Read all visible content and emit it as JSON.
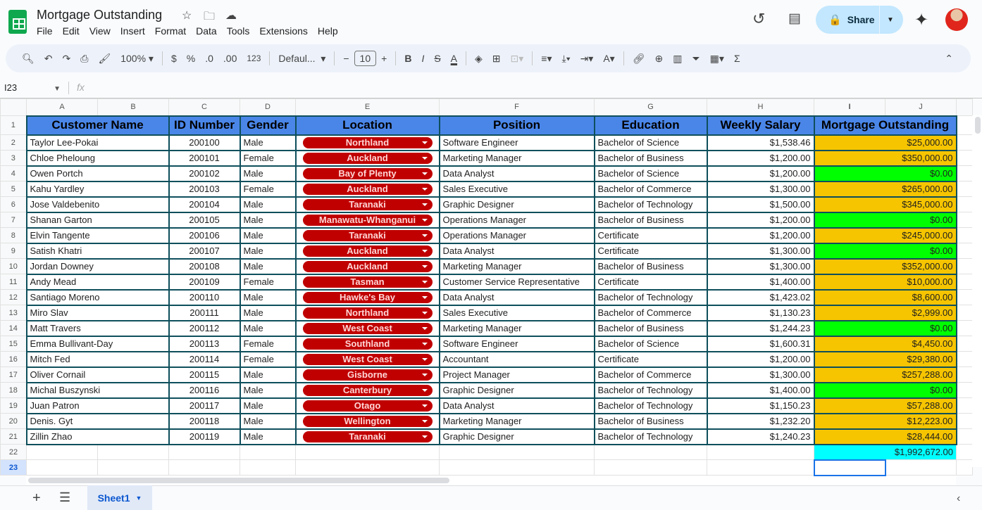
{
  "app": {
    "title": "Mortgage Outstanding",
    "menu": [
      "File",
      "Edit",
      "View",
      "Insert",
      "Format",
      "Data",
      "Tools",
      "Extensions",
      "Help"
    ],
    "share_label": "Share"
  },
  "toolbar": {
    "zoom": "100%",
    "currency": "$",
    "percent": "%",
    "dec_decrease": ".0",
    "dec_increase": ".00",
    "format_123": "123",
    "font": "Defaul...",
    "font_size": "10"
  },
  "formula_bar": {
    "name_box": "I23",
    "fx": "fx"
  },
  "columns": [
    "A",
    "B",
    "C",
    "D",
    "E",
    "F",
    "G",
    "H",
    "I",
    "J"
  ],
  "headers": {
    "name": "Customer Name",
    "id": "ID Number",
    "gender": "Gender",
    "location": "Location",
    "position": "Position",
    "education": "Education",
    "salary": "Weekly Salary",
    "mortgage": "Mortgage Outstanding"
  },
  "rows": [
    {
      "name": "Taylor Lee-Pokai",
      "id": "200100",
      "gender": "Male",
      "location": "Northland",
      "position": "Software Engineer",
      "education": "Bachelor of Science",
      "salary": "$1,538.46",
      "mortgage": "$25,000.00"
    },
    {
      "name": "Chloe Pheloung",
      "id": "200101",
      "gender": "Female",
      "location": "Auckland",
      "position": "Marketing Manager",
      "education": "Bachelor of Business",
      "salary": "$1,200.00",
      "mortgage": "$350,000.00"
    },
    {
      "name": "Owen Portch",
      "id": "200102",
      "gender": "Male",
      "location": "Bay of Plenty",
      "position": "Data Analyst",
      "education": "Bachelor of Science",
      "salary": "$1,200.00",
      "mortgage": "$0.00"
    },
    {
      "name": "Kahu Yardley",
      "id": "200103",
      "gender": "Female",
      "location": "Auckland",
      "position": "Sales Executive",
      "education": "Bachelor of Commerce",
      "salary": "$1,300.00",
      "mortgage": "$265,000.00"
    },
    {
      "name": "Jose Valdebenito",
      "id": "200104",
      "gender": "Male",
      "location": "Taranaki",
      "position": "Graphic Designer",
      "education": "Bachelor of Technology",
      "salary": "$1,500.00",
      "mortgage": "$345,000.00"
    },
    {
      "name": "Shanan Garton",
      "id": "200105",
      "gender": "Male",
      "location": "Manawatu-Whanganui",
      "position": "Operations Manager",
      "education": "Bachelor of Business",
      "salary": "$1,200.00",
      "mortgage": "$0.00"
    },
    {
      "name": "Elvin Tangente",
      "id": "200106",
      "gender": "Male",
      "location": "Taranaki",
      "position": "Operations Manager",
      "education": "Certificate",
      "salary": "$1,200.00",
      "mortgage": "$245,000.00"
    },
    {
      "name": "Satish Khatri",
      "id": "200107",
      "gender": "Male",
      "location": "Auckland",
      "position": "Data Analyst",
      "education": "Certificate",
      "salary": "$1,300.00",
      "mortgage": "$0.00"
    },
    {
      "name": "Jordan Downey",
      "id": "200108",
      "gender": "Male",
      "location": "Auckland",
      "position": "Marketing Manager",
      "education": "Bachelor of Business",
      "salary": "$1,300.00",
      "mortgage": "$352,000.00"
    },
    {
      "name": "Andy Mead",
      "id": "200109",
      "gender": "Female",
      "location": "Tasman",
      "position": "Customer Service Representative",
      "education": "Certificate",
      "salary": "$1,400.00",
      "mortgage": "$10,000.00"
    },
    {
      "name": "Santiago Moreno",
      "id": "200110",
      "gender": "Male",
      "location": "Hawke's Bay",
      "position": "Data Analyst",
      "education": "Bachelor of Technology",
      "salary": "$1,423.02",
      "mortgage": "$8,600.00"
    },
    {
      "name": "Miro Slav",
      "id": "200111",
      "gender": "Male",
      "location": "Northland",
      "position": "Sales Executive",
      "education": "Bachelor of Commerce",
      "salary": "$1,130.23",
      "mortgage": "$2,999.00"
    },
    {
      "name": "Matt Travers",
      "id": "200112",
      "gender": "Male",
      "location": "West Coast",
      "position": "Marketing Manager",
      "education": "Bachelor of Business",
      "salary": "$1,244.23",
      "mortgage": "$0.00"
    },
    {
      "name": "Emma Bullivant-Day",
      "id": "200113",
      "gender": "Female",
      "location": "Southland",
      "position": "Software Engineer",
      "education": "Bachelor of Science",
      "salary": "$1,600.31",
      "mortgage": "$4,450.00"
    },
    {
      "name": "Mitch Fed",
      "id": "200114",
      "gender": "Female",
      "location": "West Coast",
      "position": "Accountant",
      "education": "Certificate",
      "salary": "$1,200.00",
      "mortgage": "$29,380.00"
    },
    {
      "name": "Oliver Cornail",
      "id": "200115",
      "gender": "Male",
      "location": "Gisborne",
      "position": "Project Manager",
      "education": "Bachelor of Commerce",
      "salary": "$1,300.00",
      "mortgage": "$257,288.00"
    },
    {
      "name": "Michal Buszynski",
      "id": "200116",
      "gender": "Male",
      "location": "Canterbury",
      "position": "Graphic Designer",
      "education": "Bachelor of Technology",
      "salary": "$1,400.00",
      "mortgage": "$0.00"
    },
    {
      "name": "Juan Patron",
      "id": "200117",
      "gender": "Male",
      "location": "Otago",
      "position": "Data Analyst",
      "education": "Bachelor of Technology",
      "salary": "$1,150.23",
      "mortgage": "$57,288.00"
    },
    {
      "name": "Denis. Gyt",
      "id": "200118",
      "gender": "Male",
      "location": "Wellington",
      "position": "Marketing Manager",
      "education": "Bachelor of Business",
      "salary": "$1,232.20",
      "mortgage": "$12,223.00"
    },
    {
      "name": "Zillin Zhao",
      "id": "200119",
      "gender": "Male",
      "location": "Taranaki",
      "position": "Graphic Designer",
      "education": "Bachelor of Technology",
      "salary": "$1,240.23",
      "mortgage": "$28,444.00"
    }
  ],
  "total": "$1,992,672.00",
  "sheet_tab": "Sheet1",
  "colors": {
    "header": "#4a86e8",
    "chip": "#c00000",
    "mortgage_positive": "#f6c500",
    "mortgage_zero": "#00ff00",
    "total": "#00ffff"
  }
}
